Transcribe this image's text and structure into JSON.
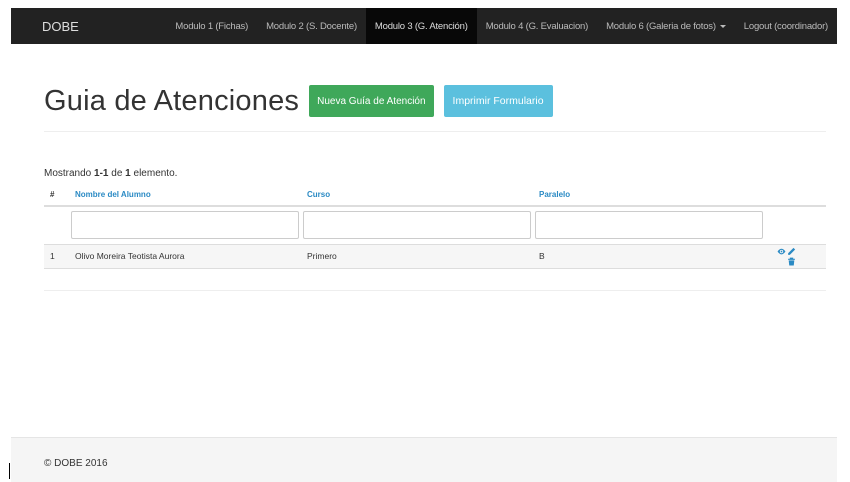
{
  "navbar": {
    "brand": "DOBE",
    "items": [
      {
        "label": "Modulo 1 (Fichas)"
      },
      {
        "label": "Modulo 2 (S. Docente)"
      },
      {
        "label": "Modulo 3 (G. Atención)",
        "active": true
      },
      {
        "label": "Modulo 4 (G. Evaluacion)"
      },
      {
        "label": "Modulo 6 (Galeria de fotos)",
        "dropdown": true
      },
      {
        "label": "Logout (coordinador)"
      }
    ]
  },
  "page": {
    "title": "Guia de Atenciones",
    "new_button": "Nueva Guía de Atención",
    "print_button": "Imprimir Formulario"
  },
  "summary": {
    "prefix": "Mostrando ",
    "range": "1-1",
    "middle": " de ",
    "total": "1",
    "suffix": " elemento."
  },
  "table": {
    "headers": {
      "index": "#",
      "name": "Nombre del Alumno",
      "course": "Curso",
      "parallel": "Paralelo"
    },
    "rows": [
      {
        "index": "1",
        "name": "Olivo Moreira Teotista Aurora",
        "course": "Primero",
        "parallel": "B"
      }
    ],
    "row_actions": [
      "eye-icon",
      "pencil-icon",
      "trash-icon"
    ],
    "action_color": "#2a8ac4"
  },
  "footer": {
    "text": "© DOBE 2016"
  },
  "colors": {
    "navbar": "#222222",
    "success": "#3fa85a",
    "info": "#5bc0de",
    "link": "#2a8ac4"
  }
}
